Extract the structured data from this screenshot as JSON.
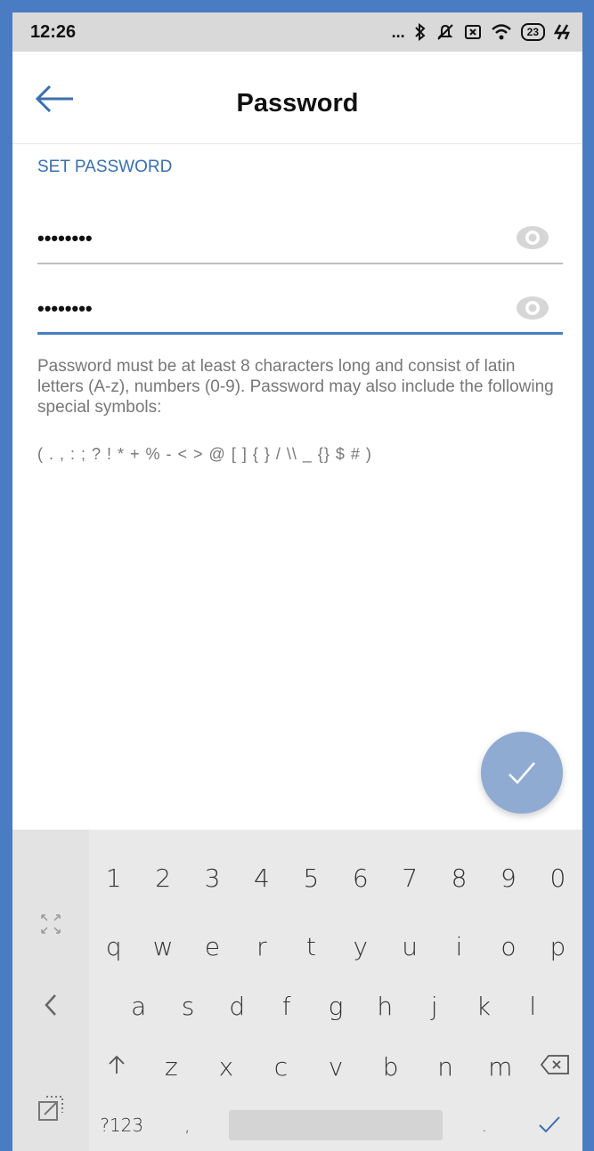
{
  "status_bar": {
    "time": "12:26",
    "more_indicator": "...",
    "battery": "23"
  },
  "header": {
    "title": "Password"
  },
  "form": {
    "section_label": "SET PASSWORD",
    "password_value": "••••••••",
    "confirm_value": "••••••••"
  },
  "hint": {
    "text": "Password must be at least 8 characters long and consist of latin letters (A-z), numbers (0-9). Password may also include the following special symbols:",
    "symbols": "( . , : ; ? ! * + % - < > @ [ ] { } / \\\\ _ {} $ # )"
  },
  "keyboard": {
    "numbers": [
      "1",
      "2",
      "3",
      "4",
      "5",
      "6",
      "7",
      "8",
      "9",
      "0"
    ],
    "row1": [
      "q",
      "w",
      "e",
      "r",
      "t",
      "y",
      "u",
      "i",
      "o",
      "p"
    ],
    "row2": [
      "a",
      "s",
      "d",
      "f",
      "g",
      "h",
      "j",
      "k",
      "l"
    ],
    "row3": [
      "z",
      "x",
      "c",
      "v",
      "b",
      "n",
      "m"
    ],
    "symbols_key": "?123",
    "comma_key": ",",
    "period_key": "."
  },
  "colors": {
    "accent": "#3a6fae",
    "fab": "#8fabd2",
    "frame": "#4a7cc3"
  }
}
